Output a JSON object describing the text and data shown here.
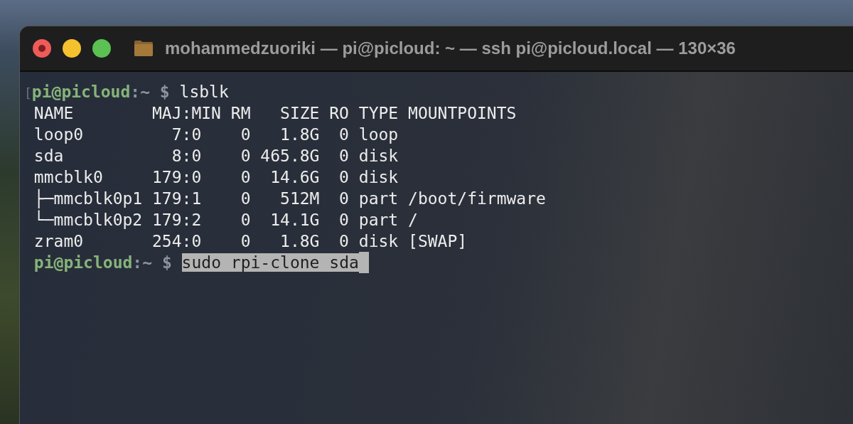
{
  "window": {
    "title": "mohammedzuoriki — pi@picloud: ~ — ssh pi@picloud.local — 130×36"
  },
  "terminal": {
    "lines": [
      {
        "kind": "prompt",
        "marker": "[",
        "user": "pi@picloud",
        "path": ":~ $",
        "command": "lsblk",
        "selected": false
      },
      {
        "kind": "output",
        "text": "NAME        MAJ:MIN RM   SIZE RO TYPE MOUNTPOINTS"
      },
      {
        "kind": "output",
        "text": "loop0         7:0    0   1.8G  0 loop"
      },
      {
        "kind": "output",
        "text": "sda           8:0    0 465.8G  0 disk"
      },
      {
        "kind": "output",
        "text": "mmcblk0     179:0    0  14.6G  0 disk"
      },
      {
        "kind": "output",
        "text": "├─mmcblk0p1 179:1    0   512M  0 part /boot/firmware"
      },
      {
        "kind": "output",
        "text": "└─mmcblk0p2 179:2    0  14.1G  0 part /"
      },
      {
        "kind": "output",
        "text": "zram0       254:0    0   1.8G  0 disk [SWAP]"
      },
      {
        "kind": "prompt",
        "user": "pi@picloud",
        "path": ":~ $",
        "command": "sudo rpi-clone sda",
        "selected": true
      }
    ]
  }
}
